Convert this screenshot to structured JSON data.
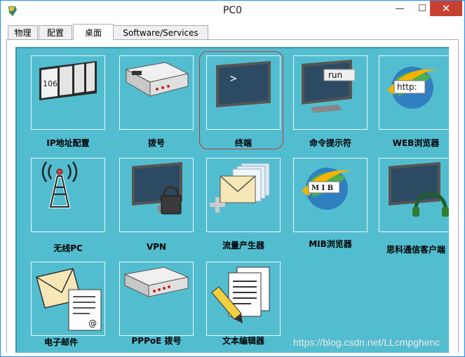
{
  "window": {
    "title": "PC0"
  },
  "controls": {
    "minimize": "—",
    "maximize": "☐",
    "close": "✕"
  },
  "tabs": [
    {
      "label": "物理"
    },
    {
      "label": "配置"
    },
    {
      "label": "桌面"
    },
    {
      "label": "Software/Services"
    }
  ],
  "apps": [
    {
      "label": "IP地址配置"
    },
    {
      "label": "拨号"
    },
    {
      "label": "终端"
    },
    {
      "label": "命令提示符"
    },
    {
      "label": "WEB浏览器"
    },
    {
      "label": "无线PC"
    },
    {
      "label": "VPN"
    },
    {
      "label": "流量产生器"
    },
    {
      "label": "MIB浏览器"
    },
    {
      "label": "思科通信客户端"
    },
    {
      "label": "电子邮件"
    },
    {
      "label": "PPPoE 拨号"
    },
    {
      "label": "文本编辑器"
    }
  ],
  "icons": {
    "ip_panel_text": "106",
    "terminal_prompt": ">",
    "cmd_text": "run",
    "web_text": "http:",
    "mib_text": "M I B",
    "email_at": "@"
  },
  "watermark": "https://blog.csdn.net/LLcmpghenc",
  "colors": {
    "desktop": "#53bdd0",
    "close": "#c84031",
    "selection": "#b34040"
  }
}
